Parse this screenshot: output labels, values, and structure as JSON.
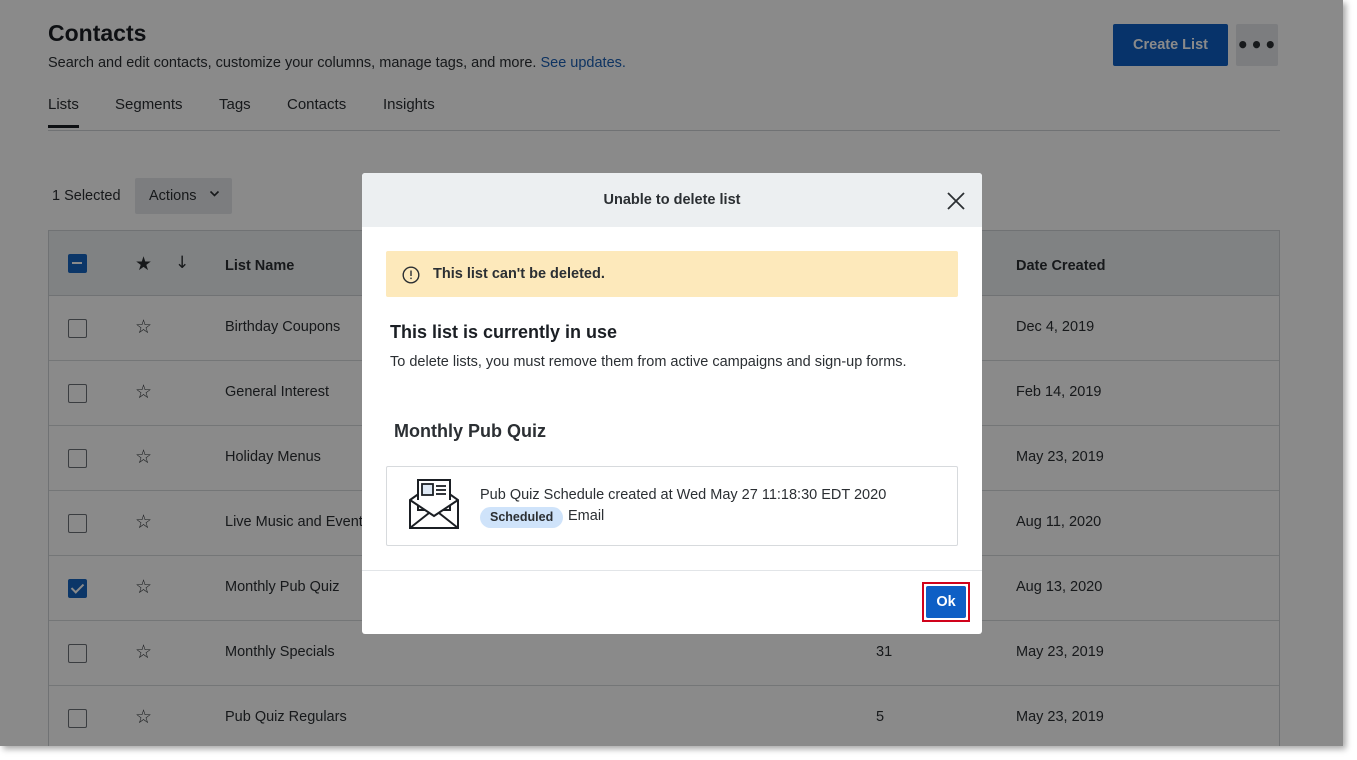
{
  "page": {
    "title": "Contacts",
    "subtitle": "Search and edit contacts, customize your columns, manage tags, and more.",
    "subtitle_link": "See updates.",
    "create_button": "Create List",
    "more_button": "•••"
  },
  "tabs": [
    {
      "label": "Lists",
      "active": true
    },
    {
      "label": "Segments",
      "active": false
    },
    {
      "label": "Tags",
      "active": false
    },
    {
      "label": "Contacts",
      "active": false
    },
    {
      "label": "Insights",
      "active": false
    }
  ],
  "toolbar": {
    "selected_label": "1 Selected",
    "actions_label": "Actions",
    "actions_chevron": "⌵"
  },
  "table": {
    "headers": {
      "star": "★",
      "sort": "↓",
      "list_name": "List Name",
      "date_created": "Date Created"
    },
    "rows": [
      {
        "name": "Birthday Coupons",
        "count": "",
        "date": "Dec 4, 2019",
        "checked": false
      },
      {
        "name": "General Interest",
        "count": "",
        "date": "Feb 14, 2019",
        "checked": false
      },
      {
        "name": "Holiday Menus",
        "count": "",
        "date": "May 23, 2019",
        "checked": false
      },
      {
        "name": "Live Music and Events",
        "count": "",
        "date": "Aug 11, 2020",
        "checked": false
      },
      {
        "name": "Monthly Pub Quiz",
        "count": "",
        "date": "Aug 13, 2020",
        "checked": true
      },
      {
        "name": "Monthly Specials",
        "count": "31",
        "date": "May 23, 2019",
        "checked": false
      },
      {
        "name": "Pub Quiz Regulars",
        "count": "5",
        "date": "May 23, 2019",
        "checked": false
      }
    ],
    "star_glyph": "☆"
  },
  "modal": {
    "title": "Unable to delete list",
    "alert": "This list can't be deleted.",
    "heading": "This list is currently in use",
    "description": "To delete lists, you must remove them from active campaigns and sign-up forms.",
    "list_name": "Monthly Pub Quiz",
    "campaign": {
      "name": "Pub Quiz Schedule created at Wed May 27 11:18:30 EDT 2020",
      "status": "Scheduled",
      "type": "Email"
    },
    "ok_button": "Ok"
  },
  "colors": {
    "primary": "#0e5fc5",
    "alert_bg": "#fde9bb",
    "badge_bg": "#cfe3fa",
    "highlight": "#d0021b"
  }
}
